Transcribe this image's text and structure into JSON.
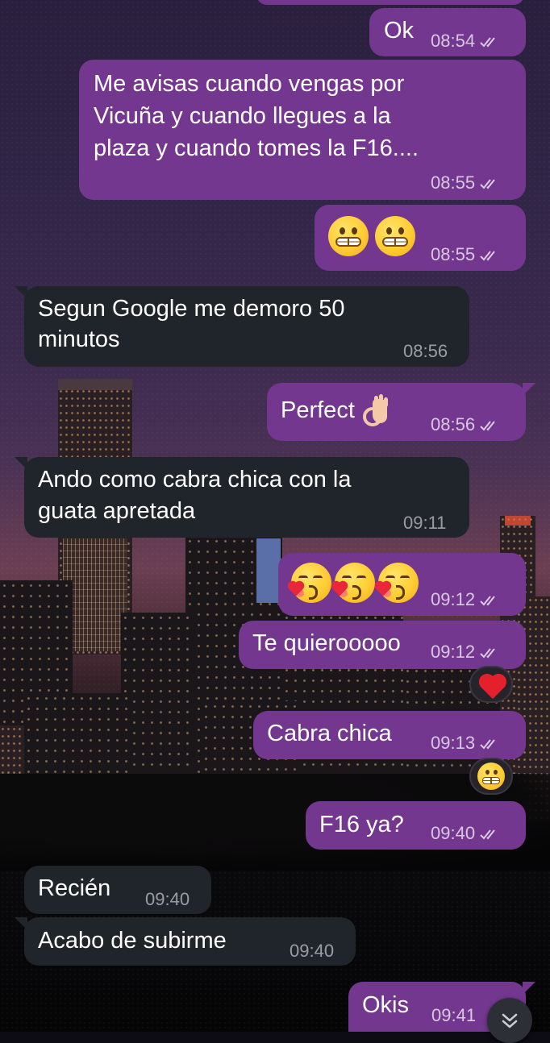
{
  "messages": [
    {
      "id": "m1",
      "dir": "out",
      "text": "Ok",
      "time": "08:54"
    },
    {
      "id": "m2",
      "dir": "out",
      "lines": [
        "Me avisas cuando vengas por",
        "Vicuña y cuando llegues a la",
        "plaza y cuando tomes la F16...."
      ],
      "time": "08:55"
    },
    {
      "id": "m3",
      "dir": "out",
      "emoji": [
        "grimacing-face",
        "grimacing-face"
      ],
      "time": "08:55"
    },
    {
      "id": "m4",
      "dir": "in",
      "lines": [
        "Segun Google me demoro 50",
        "minutos"
      ],
      "time": "08:56"
    },
    {
      "id": "m5",
      "dir": "out",
      "text": "Perfect",
      "emoji": "ok-hand",
      "time": "08:56"
    },
    {
      "id": "m6",
      "dir": "in",
      "lines": [
        "Ando como cabra chica con la",
        "guata apretada"
      ],
      "time": "09:11"
    },
    {
      "id": "m7",
      "dir": "out",
      "emoji": [
        "face-blowing-kiss",
        "face-blowing-kiss",
        "face-blowing-kiss"
      ],
      "time": "09:12"
    },
    {
      "id": "m8",
      "dir": "out",
      "text": "Te quierooooo",
      "time": "09:12",
      "reaction": "red-heart"
    },
    {
      "id": "m9",
      "dir": "out",
      "text": "Cabra chica",
      "time": "09:13",
      "reaction": "grimacing-face"
    },
    {
      "id": "m10",
      "dir": "out",
      "text": "F16 ya?",
      "time": "09:40"
    },
    {
      "id": "m11",
      "dir": "in",
      "text": "Recién",
      "time": "09:40"
    },
    {
      "id": "m12",
      "dir": "in",
      "text": "Acabo de subirme",
      "time": "09:40"
    },
    {
      "id": "m13",
      "dir": "out",
      "text": "Okis",
      "time": "09:41"
    }
  ],
  "colors": {
    "outgoing": "#74378f",
    "incoming": "#20252b",
    "text": "#ffffff"
  },
  "icons": {
    "read": "double-check-icon",
    "scroll": "chevron-double-down-icon"
  }
}
